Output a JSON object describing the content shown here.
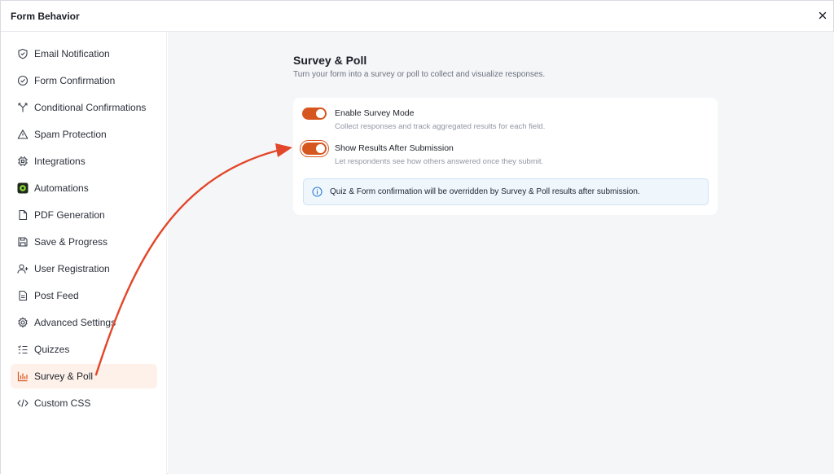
{
  "header": {
    "title": "Form Behavior"
  },
  "sidebar": {
    "items": [
      {
        "label": "Email Notification",
        "icon": "shield-check-icon"
      },
      {
        "label": "Form Confirmation",
        "icon": "circle-check-icon"
      },
      {
        "label": "Conditional Confirmations",
        "icon": "branch-icon"
      },
      {
        "label": "Spam Protection",
        "icon": "warning-icon"
      },
      {
        "label": "Integrations",
        "icon": "chip-icon"
      },
      {
        "label": "Automations",
        "icon": "automations-logo-icon"
      },
      {
        "label": "PDF Generation",
        "icon": "file-icon"
      },
      {
        "label": "Save & Progress",
        "icon": "floppy-icon"
      },
      {
        "label": "User Registration",
        "icon": "user-plus-icon"
      },
      {
        "label": "Post Feed",
        "icon": "document-icon"
      },
      {
        "label": "Advanced Settings",
        "icon": "gear-icon"
      },
      {
        "label": "Quizzes",
        "icon": "checklist-icon"
      },
      {
        "label": "Survey & Poll",
        "icon": "bar-chart-icon"
      },
      {
        "label": "Custom CSS",
        "icon": "code-icon"
      }
    ],
    "active_index": 12
  },
  "main": {
    "title": "Survey & Poll",
    "subtitle": "Turn your form into a survey or poll to collect and visualize responses.",
    "options": [
      {
        "title": "Enable Survey Mode",
        "description": "Collect responses and track aggregated results for each field.",
        "enabled": true
      },
      {
        "title": "Show Results After Submission",
        "description": "Let respondents see how others answered once they submit.",
        "enabled": true
      }
    ],
    "info_text": "Quiz & Form confirmation will be overridden by Survey & Poll results after submission."
  },
  "colors": {
    "accent": "#d6561f",
    "annotation_arrow": "#e2472a",
    "active_bg": "#fdf1ea",
    "info_bg": "#eff6fc",
    "info_icon": "#2f7fd6"
  }
}
